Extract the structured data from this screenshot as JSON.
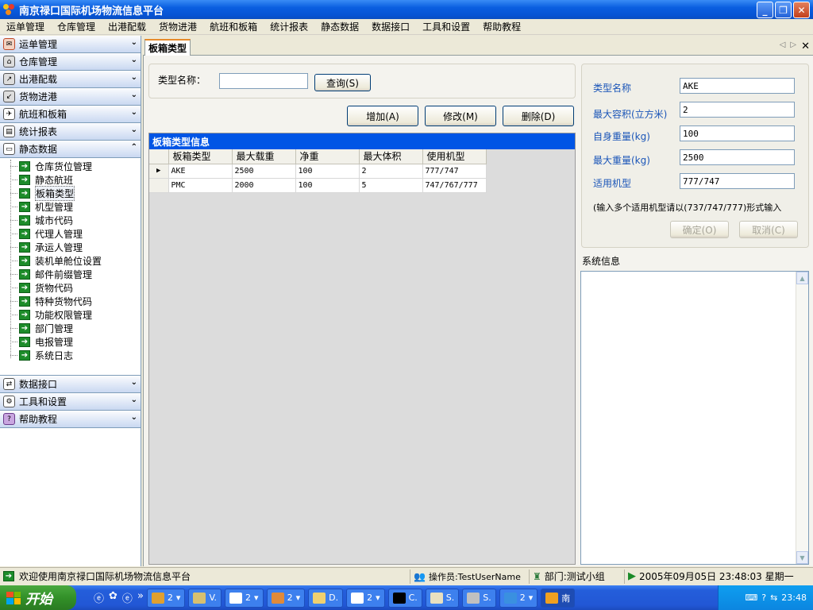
{
  "window": {
    "title": "南京禄口国际机场物流信息平台",
    "buttons": [
      "_",
      "❐",
      "✕"
    ]
  },
  "menubar": [
    "运单管理",
    "仓库管理",
    "出港配载",
    "货物进港",
    "航班和板箱",
    "统计报表",
    "静态数据",
    "数据接口",
    "工具和设置",
    "帮助教程"
  ],
  "nav": {
    "groups_top": [
      {
        "label": "运单管理",
        "icon": "waybill-icon"
      },
      {
        "label": "仓库管理",
        "icon": "warehouse-icon"
      },
      {
        "label": "出港配载",
        "icon": "outbound-icon"
      },
      {
        "label": "货物进港",
        "icon": "inbound-icon"
      },
      {
        "label": "航班和板箱",
        "icon": "flight-icon"
      },
      {
        "label": "统计报表",
        "icon": "report-icon"
      }
    ],
    "expanded_group": {
      "label": "静态数据",
      "icon": "static-data-icon"
    },
    "subitems": [
      "仓库货位管理",
      "静态航班",
      "板箱类型",
      "机型管理",
      "城市代码",
      "代理人管理",
      "承运人管理",
      "装机单舱位设置",
      "邮件前缀管理",
      "货物代码",
      "特种货物代码",
      "功能权限管理",
      "部门管理",
      "电报管理",
      "系统日志"
    ],
    "active_subitem": "板箱类型",
    "groups_bottom": [
      {
        "label": "数据接口",
        "icon": "data-interface-icon"
      },
      {
        "label": "工具和设置",
        "icon": "tools-icon"
      },
      {
        "label": "帮助教程",
        "icon": "help-icon"
      }
    ]
  },
  "tab": {
    "label": "板箱类型"
  },
  "search": {
    "label": "类型名称：",
    "value": "",
    "query_btn": "查询(S)"
  },
  "actions": {
    "add": "增加(A)",
    "edit": "修改(M)",
    "delete": "删除(D)"
  },
  "grid": {
    "caption": "板箱类型信息",
    "columns": [
      "板箱类型",
      "最大载重",
      "净重",
      "最大体积",
      "使用机型"
    ],
    "rows": [
      [
        "AKE",
        "2500",
        "100",
        "2",
        "777/747"
      ],
      [
        "PMC",
        "2000",
        "100",
        "5",
        "747/767/777"
      ]
    ],
    "current_row_marker": "▶"
  },
  "form": {
    "type_name": {
      "label": "类型名称",
      "value": "AKE"
    },
    "max_volume": {
      "label": "最大容积(立方米)",
      "value": "2"
    },
    "self_weight": {
      "label": "自身重量(kg)",
      "value": "100"
    },
    "max_weight": {
      "label": "最大重量(kg)",
      "value": "2500"
    },
    "aircraft": {
      "label": "适用机型",
      "value": "777/747"
    },
    "hint": "(输入多个适用机型请以(737/747/777)形式输入",
    "ok_btn": "确定(O)",
    "cancel_btn": "取消(C)"
  },
  "sysinfo": {
    "title": "系统信息"
  },
  "statusbar": {
    "welcome": "欢迎使用南京禄口国际机场物流信息平台",
    "operator": "操作员:TestUserName",
    "dept": "部门:测试小组",
    "datetime": "2005年09月05日 23:48:03 星期一"
  },
  "taskbar": {
    "start": "开始",
    "buttons": [
      "2",
      "V.",
      "2",
      "2",
      "D.",
      "2",
      "C.",
      "S.",
      "S.",
      "2",
      "南"
    ],
    "clock": "23:48"
  },
  "colors": {
    "title_blue": "#0653d4",
    "grid_caption": "#0055e5",
    "start_green": "#329028",
    "label_blue": "#1a55b8"
  }
}
